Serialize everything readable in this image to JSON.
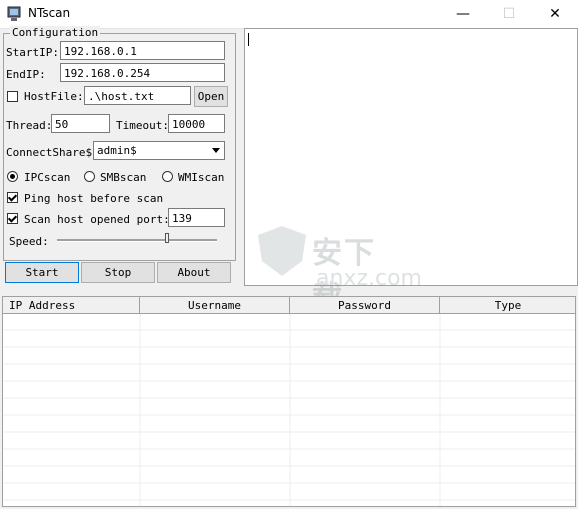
{
  "window": {
    "title": "NTscan",
    "minimize": "—",
    "maximize": "☐",
    "close": "✕"
  },
  "config": {
    "legend": "Configuration",
    "start_ip_label": "StartIP:",
    "start_ip": "192.168.0.1",
    "end_ip_label": "EndIP:",
    "end_ip": "192.168.0.254",
    "hostfile_label": "HostFile:",
    "hostfile_checked": false,
    "hostfile": ".\\host.txt",
    "open_button": "Open",
    "thread_label": "Thread:",
    "thread": "50",
    "timeout_label": "Timeout:",
    "timeout": "10000",
    "share_label": "ConnectShare$:",
    "share_value": "admin$",
    "scan_modes": [
      {
        "label": "IPCscan",
        "selected": true
      },
      {
        "label": "SMBscan",
        "selected": false
      },
      {
        "label": "WMIscan",
        "selected": false
      }
    ],
    "ping_label": "Ping host before scan",
    "ping_checked": true,
    "port_label": "Scan host opened port:",
    "port_checked": true,
    "port": "139",
    "speed_label": "Speed:",
    "speed_fraction": 0.69
  },
  "buttons": {
    "start": "Start",
    "stop": "Stop",
    "about": "About"
  },
  "watermark": {
    "cn": "安下载",
    "en": "anxz.com"
  },
  "table": {
    "columns": [
      "IP Address",
      "Username",
      "Password",
      "Type"
    ]
  }
}
